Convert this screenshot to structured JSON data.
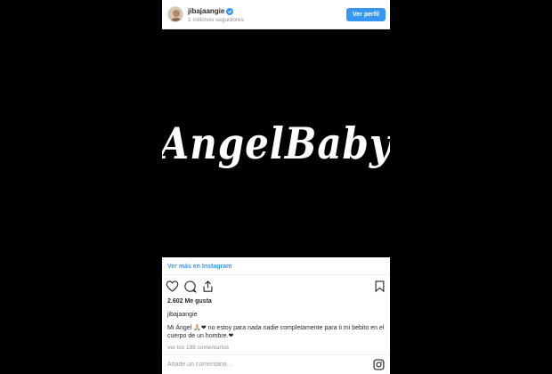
{
  "header": {
    "username": "jibajaangie",
    "followers": "1 millones seguidores",
    "view_profile_label": "Ver perfil",
    "avatar_icon": "avatar-icon",
    "verified_icon": "verified-badge-icon"
  },
  "image": {
    "text": "AngelBaby"
  },
  "view_more_label": "Ver más en Instagram",
  "actions": {
    "like_icon": "heart-icon",
    "comment_icon": "comment-icon",
    "share_icon": "share-icon",
    "save_icon": "bookmark-icon"
  },
  "likes": "2.602 Me gusta",
  "caption": {
    "username": "jibajaangie",
    "text": "Mi Ángel 🙏🏼❤ no estoy para nada nadie completamente para ti mi bebito en el cuerpo de un hombre.❤"
  },
  "comments_link": "ver los 199 comentarios",
  "comment_box": {
    "placeholder": "Añade un comentario...",
    "instagram_icon": "instagram-logo-icon"
  },
  "colors": {
    "accent": "#3897f0",
    "background": "#000000",
    "text": "#262626",
    "muted": "#8e8e8e"
  }
}
